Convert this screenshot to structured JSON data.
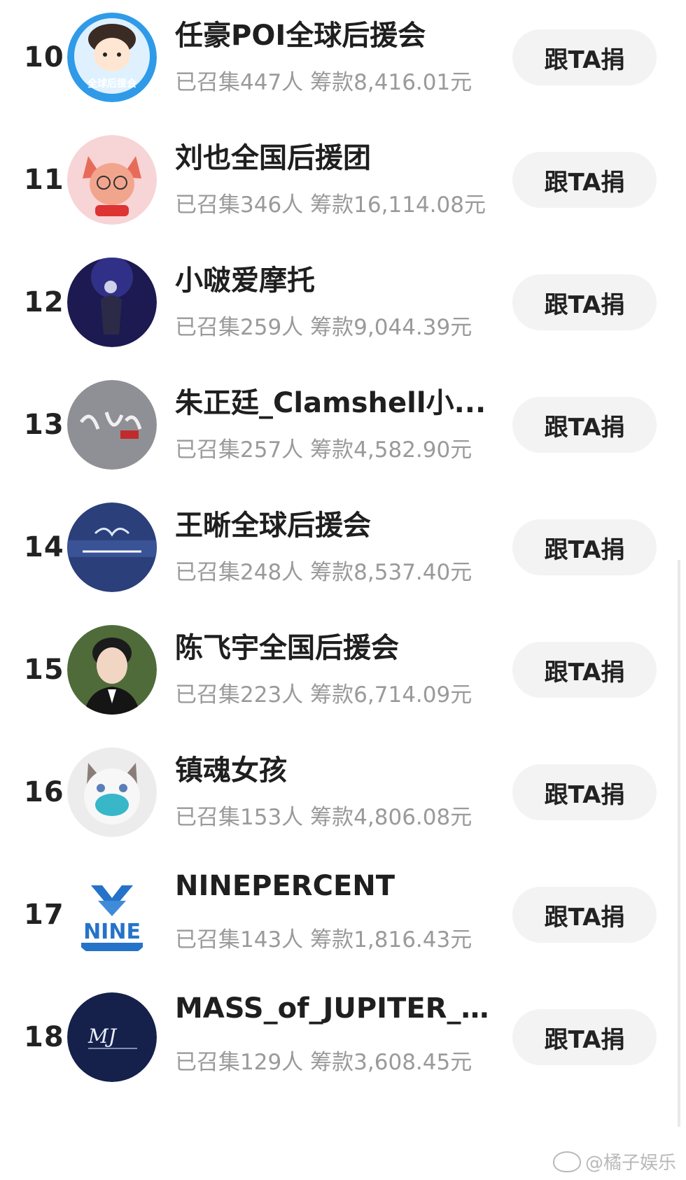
{
  "donate_label": "跟TA捐",
  "rows": [
    {
      "rank": "10",
      "name": "任豪POI全球后援会",
      "count_text": "已召集447人",
      "amount_text": "筹款8,416.01元",
      "avatar": "cartoon-boy-avatar"
    },
    {
      "rank": "11",
      "name": "刘也全国后援团",
      "count_text": "已召集346人",
      "amount_text": "筹款16,114.08元",
      "avatar": "cartoon-fox-avatar"
    },
    {
      "rank": "12",
      "name": "小啵爱摩托",
      "count_text": "已召集259人",
      "amount_text": "筹款9,044.39元",
      "avatar": "stage-performer-avatar"
    },
    {
      "rank": "13",
      "name": "朱正廷_Clamshell小...",
      "count_text": "已召集257人",
      "amount_text": "筹款4,582.90元",
      "avatar": "calligraphy-avatar"
    },
    {
      "rank": "14",
      "name": "王晰全球后援会",
      "count_text": "已召集248人",
      "amount_text": "筹款8,537.40元",
      "avatar": "fanclub-logo-avatar"
    },
    {
      "rank": "15",
      "name": "陈飞宇全国后援会",
      "count_text": "已召集223人",
      "amount_text": "筹款6,714.09元",
      "avatar": "portrait-avatar"
    },
    {
      "rank": "16",
      "name": "镇魂女孩",
      "count_text": "已召集153人",
      "amount_text": "筹款4,806.08元",
      "avatar": "masked-cat-avatar"
    },
    {
      "rank": "17",
      "name": "NINEPERCENT",
      "count_text": "已召集143人",
      "amount_text": "筹款1,816.43元",
      "avatar": "nine-percent-logo-avatar"
    },
    {
      "rank": "18",
      "name": "MASS_of_JUPITER_...",
      "count_text": "已召集129人",
      "amount_text": "筹款3,608.45元",
      "avatar": "mass-of-jupiter-avatar"
    }
  ],
  "avatar_logo_texts": {
    "cartoon-boy-avatar": "全球后援会",
    "nine-percent-logo-avatar": "NINE",
    "mass-of-jupiter-avatar": "MJ"
  },
  "watermark": "@橘子娱乐"
}
